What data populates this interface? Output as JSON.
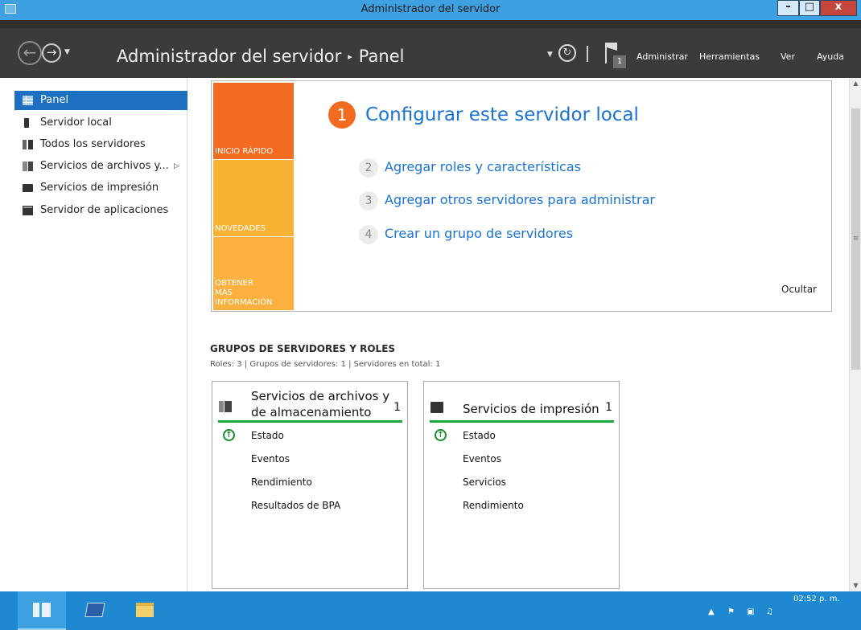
{
  "window": {
    "title": "Administrador del servidor",
    "controls": {
      "minimize": "–",
      "maximize": "□",
      "close": "x"
    }
  },
  "header": {
    "breadcrumb_root": "Administrador del servidor",
    "breadcrumb_sep": "▸",
    "breadcrumb_current": "Panel",
    "notifications_count": "1",
    "menu": [
      "Administrar",
      "Herramientas",
      "Ver",
      "Ayuda"
    ]
  },
  "sidebar": {
    "items": [
      {
        "label": "Panel",
        "icon": "dashboard-icon",
        "active": true
      },
      {
        "label": "Servidor local",
        "icon": "server-icon"
      },
      {
        "label": "Todos los servidores",
        "icon": "servers-icon"
      },
      {
        "label": "Servicios de archivos y...",
        "icon": "file-services-icon",
        "has_submenu": true
      },
      {
        "label": "Servicios de impresión",
        "icon": "printer-icon"
      },
      {
        "label": "Servidor de aplicaciones",
        "icon": "app-server-icon"
      }
    ]
  },
  "welcome": {
    "tiles": [
      "INICIO RÁPIDO",
      "NOVEDADES",
      "OBTENER MÁS INFORMACIÓN"
    ],
    "steps": [
      {
        "num": "1",
        "label": "Configurar este servidor local"
      },
      {
        "num": "2",
        "label": "Agregar roles y características"
      },
      {
        "num": "3",
        "label": "Agregar otros servidores para administrar"
      },
      {
        "num": "4",
        "label": "Crear un grupo de servidores"
      }
    ],
    "hide": "Ocultar"
  },
  "roles": {
    "title": "GRUPOS DE SERVIDORES Y ROLES",
    "summary": "Roles: 3  |  Grupos de servidores: 1  |  Servidores en total: 1",
    "cards": [
      {
        "title_line1": "Servicios de archivos y",
        "title_line2": "de almacenamiento",
        "count": "1",
        "rows": [
          "Estado",
          "Eventos",
          "Rendimiento",
          "Resultados de BPA"
        ]
      },
      {
        "title_line1": "Servicios de impresión",
        "title_line2": "",
        "count": "1",
        "rows": [
          "Estado",
          "Eventos",
          "Servicios",
          "Rendimiento"
        ]
      }
    ]
  },
  "taskbar": {
    "clock": "02:52 p. m."
  },
  "colors": {
    "accent_blue": "#1d6fbf",
    "quick_start_orange": "#f26b21",
    "tile_yellow": "#f9b233",
    "status_green": "#1aa73c",
    "header_dark": "#3b3b3b",
    "taskbar_blue": "#1e88d1"
  }
}
